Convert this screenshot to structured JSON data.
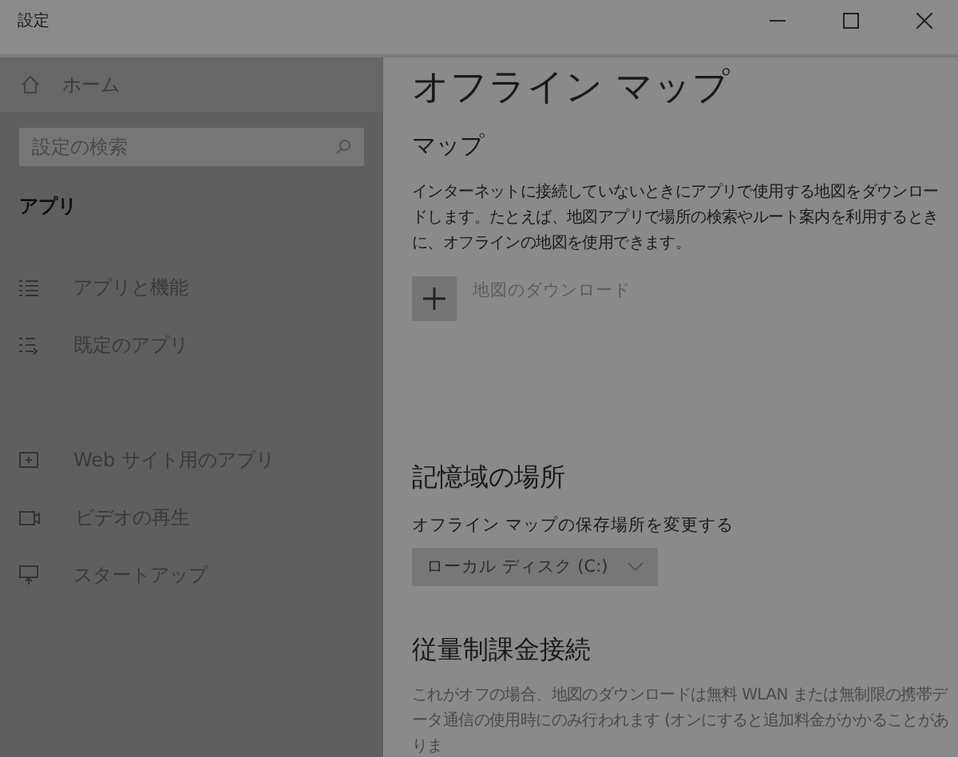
{
  "window": {
    "title": "設定"
  },
  "sidebar": {
    "home": "ホーム",
    "search": {
      "placeholder": "設定の検索"
    },
    "section": "アプリ",
    "items_top": [
      {
        "label": "アプリと機能",
        "kind": "list"
      },
      {
        "label": "既定のアプリ",
        "kind": "defaults"
      }
    ],
    "items_bottom": [
      {
        "label": "Web サイト用のアプリ",
        "kind": "web"
      },
      {
        "label": "ビデオの再生",
        "kind": "video"
      },
      {
        "label": "スタートアップ",
        "kind": "startup"
      }
    ]
  },
  "page": {
    "title": "オフライン マップ",
    "maps_heading": "マップ",
    "maps_text": "インターネットに接続していないときにアプリで使用する地図をダウンロードします。たとえば、地図アプリで場所の検索やルート案内を利用するときに、オフラインの地図を使用できます。",
    "download_button": "地図のダウンロード",
    "storage_heading": "記憶域の場所",
    "storage_label": "オフライン マップの保存場所を変更する",
    "storage_dropdown": "ローカル ディスク (C:)",
    "metered_heading": "従量制課金接続",
    "metered_text": "これがオフの場合、地図のダウンロードは無料 WLAN または無制限の携帯データ通信の使用時にのみ行われます (オンにすると追加料金がかかることがありま"
  }
}
